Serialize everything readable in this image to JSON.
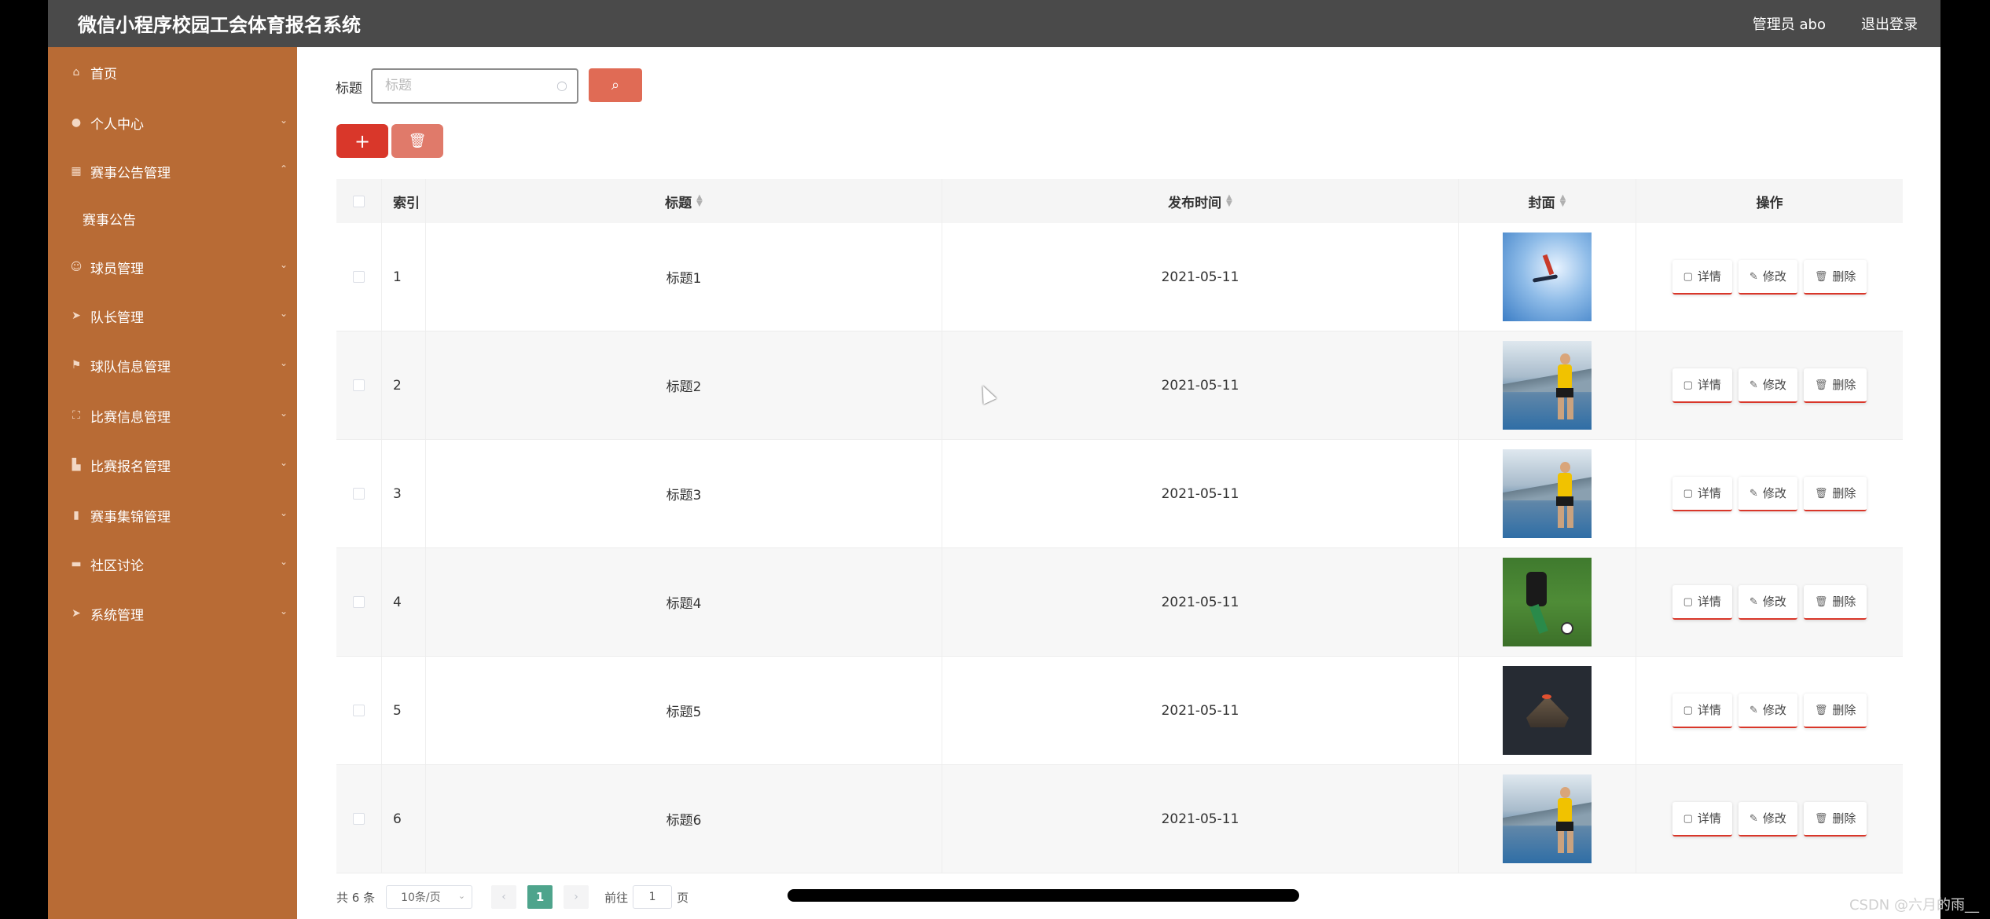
{
  "header": {
    "title": "微信小程序校园工会体育报名系统",
    "user": "管理员 abo",
    "logout": "退出登录"
  },
  "sidebar": {
    "items": [
      {
        "label": "首页",
        "icon": "home-icon",
        "expandable": false
      },
      {
        "label": "个人中心",
        "icon": "user-icon",
        "expandable": true
      },
      {
        "label": "赛事公告管理",
        "icon": "calendar-icon",
        "expandable": true,
        "expanded": true
      },
      {
        "label": "赛事公告",
        "icon": "",
        "expandable": false,
        "sub": true
      },
      {
        "label": "球员管理",
        "icon": "smile-icon",
        "expandable": true
      },
      {
        "label": "队长管理",
        "icon": "send-icon",
        "expandable": true
      },
      {
        "label": "球队信息管理",
        "icon": "flag-icon",
        "expandable": true
      },
      {
        "label": "比赛信息管理",
        "icon": "fullscreen-icon",
        "expandable": true
      },
      {
        "label": "比赛报名管理",
        "icon": "building-icon",
        "expandable": true
      },
      {
        "label": "赛事集锦管理",
        "icon": "chart-icon",
        "expandable": true
      },
      {
        "label": "社区讨论",
        "icon": "monitor-icon",
        "expandable": true
      },
      {
        "label": "系统管理",
        "icon": "send-icon",
        "expandable": true
      }
    ]
  },
  "search": {
    "label": "标题",
    "placeholder": "标题",
    "value": ""
  },
  "table": {
    "headers": {
      "index": "索引",
      "title": "标题",
      "time": "发布时间",
      "cover": "封面",
      "ops": "操作"
    },
    "rows": [
      {
        "index": "1",
        "title": "标题1",
        "time": "2021-05-11",
        "cover": "sky"
      },
      {
        "index": "2",
        "title": "标题2",
        "time": "2021-05-11",
        "cover": "runner"
      },
      {
        "index": "3",
        "title": "标题3",
        "time": "2021-05-11",
        "cover": "runner"
      },
      {
        "index": "4",
        "title": "标题4",
        "time": "2021-05-11",
        "cover": "soccer"
      },
      {
        "index": "5",
        "title": "标题5",
        "time": "2021-05-11",
        "cover": "dark"
      },
      {
        "index": "6",
        "title": "标题6",
        "time": "2021-05-11",
        "cover": "runner"
      }
    ],
    "ops": {
      "detail": "详情",
      "edit": "修改",
      "delete": "删除"
    }
  },
  "pagination": {
    "total": "共 6 条",
    "page_size": "10条/页",
    "current": "1",
    "goto_label": "前往",
    "goto_value": "1",
    "page_unit": "页"
  },
  "watermark": "CSDN @六月的雨__",
  "colors": {
    "sidebar": "#b86b35",
    "header": "#4a4a4a",
    "primary_red": "#d9372a",
    "page_active": "#4ea48c"
  }
}
